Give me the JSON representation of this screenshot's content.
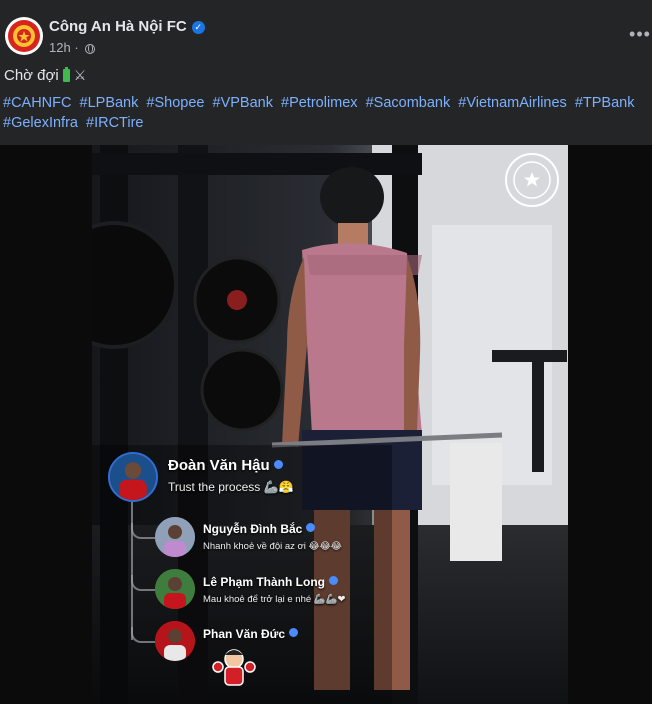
{
  "post": {
    "page_name": "Công An Hà Nội FC",
    "time": "12h",
    "caption": "Chờ đợi",
    "caption_icons": [
      "battery-icon",
      "crossed-swords-icon"
    ],
    "hashtags": [
      "#CAHNFC",
      "#LPBank",
      "#Shopee",
      "#VPBank",
      "#Petrolimex",
      "#Sacombank",
      "#VietnamAirlines",
      "#TPBank",
      "#GelexInfra",
      "#IRCTire"
    ]
  },
  "photo": {
    "watermark_icon": "club-crest-icon",
    "story": {
      "author": "Đoàn Văn Hậu",
      "text": "Trust the process",
      "replies": [
        {
          "name": "Nguyễn Đình Bắc",
          "text": "Nhanh khoẻ về đội az ơi"
        },
        {
          "name": "Lê Phạm Thành Long",
          "text": "Mau khoẻ để trở lại e nhé"
        },
        {
          "name": "Phan Văn Đức",
          "text": ""
        }
      ]
    }
  },
  "colors": {
    "background": "#242526",
    "text": "#e4e6eb",
    "hashtag": "#7cb0ff",
    "verified": "#1b74e4"
  }
}
